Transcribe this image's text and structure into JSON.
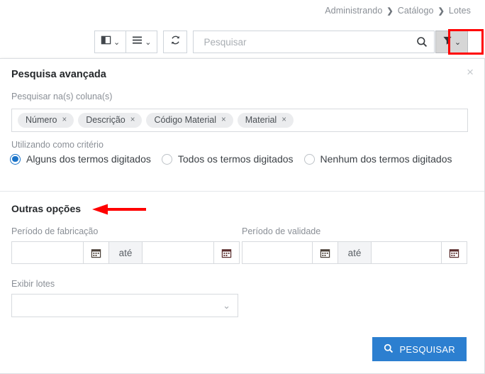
{
  "breadcrumb": {
    "items": [
      "Administrando",
      "Catálogo",
      "Lotes"
    ],
    "separator": "❯"
  },
  "toolbar": {
    "columns_button": {
      "icon": "columns-icon",
      "chevron": "⌄"
    },
    "list_button": {
      "icon": "list-icon",
      "chevron": "⌄"
    },
    "refresh_button": {
      "icon": "refresh-icon"
    },
    "search": {
      "value": "",
      "placeholder": "Pesquisar"
    },
    "search_icon": "search-icon",
    "filter_button": {
      "icon": "filter-icon",
      "chevron": "⌄",
      "highlight_color": "#ff0000",
      "active": true
    }
  },
  "panel": {
    "title": "Pesquisa avançada",
    "close_label": "×",
    "columns_field": {
      "label": "Pesquisar na(s) coluna(s)",
      "chips": [
        {
          "label": "Número",
          "remove": "×"
        },
        {
          "label": "Descrição",
          "remove": "×"
        },
        {
          "label": "Código Material",
          "remove": "×"
        },
        {
          "label": "Material",
          "remove": "×"
        }
      ]
    },
    "criteria": {
      "label": "Utilizando como critério",
      "options": [
        {
          "label": "Alguns dos termos digitados",
          "selected": true
        },
        {
          "label": "Todos os termos digitados",
          "selected": false
        },
        {
          "label": "Nenhum dos termos digitados",
          "selected": false
        }
      ]
    },
    "other_options": {
      "title": "Outras opções",
      "annotation": {
        "type": "arrow",
        "direction": "left",
        "color": "#ff0000"
      },
      "date_ranges": [
        {
          "label": "Período de fabricação",
          "from_value": "",
          "to_value": "",
          "separator": "até",
          "calendar_icon": "calendar-icon"
        },
        {
          "label": "Período de validade",
          "from_value": "",
          "to_value": "",
          "separator": "até",
          "calendar_icon": "calendar-icon"
        }
      ],
      "display_lots": {
        "label": "Exibir lotes",
        "value": "",
        "chevron": "⌄"
      }
    },
    "submit": {
      "label": "PESQUISAR",
      "icon": "search-icon",
      "color": "#2c7fd0"
    }
  }
}
